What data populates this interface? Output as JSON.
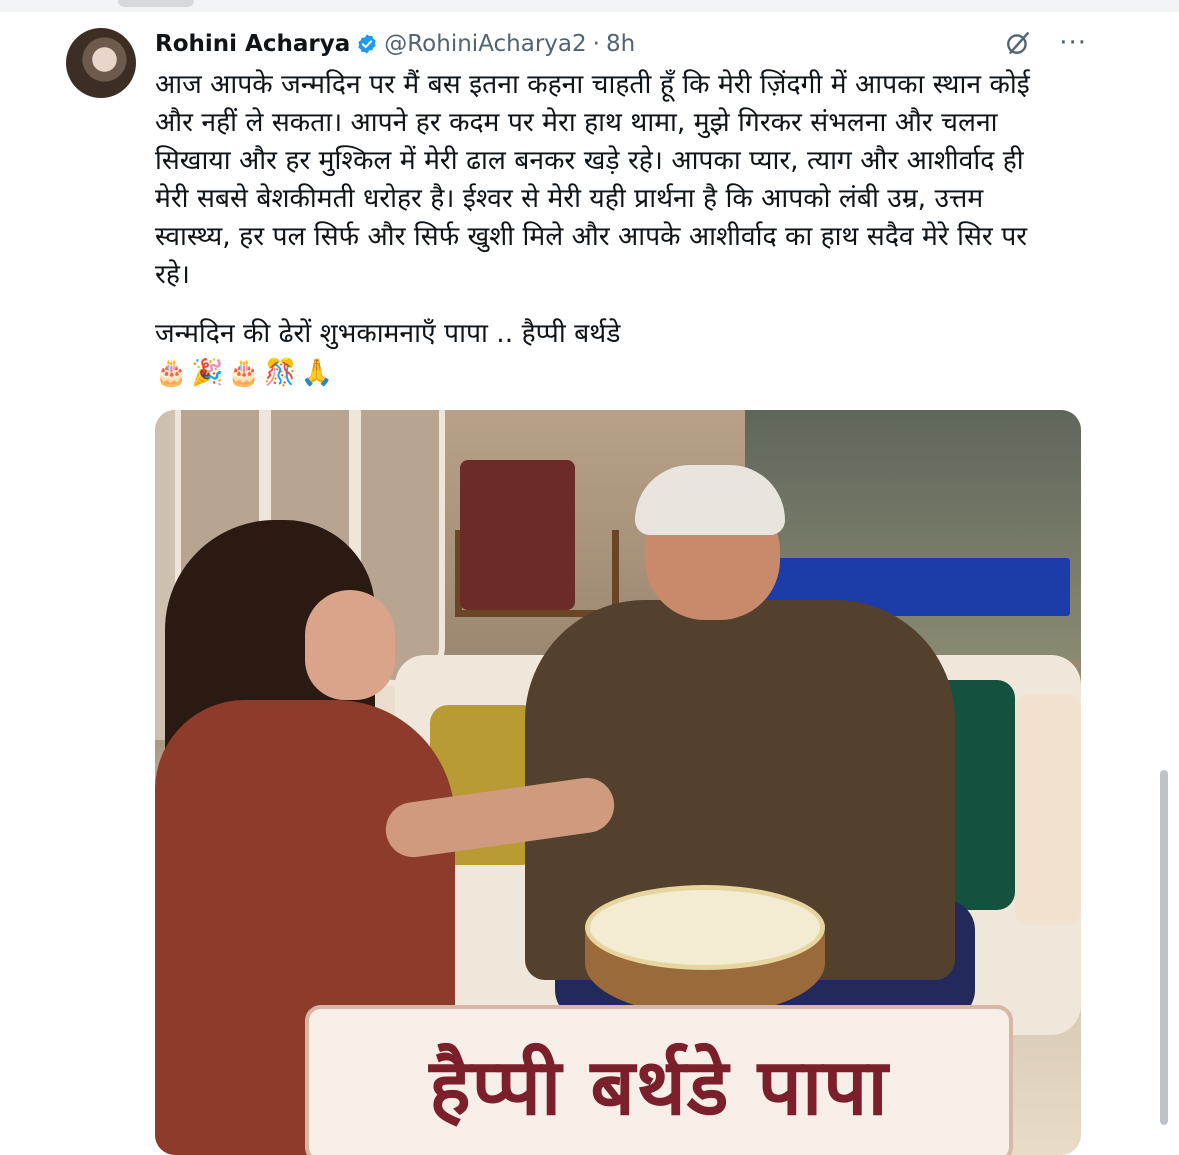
{
  "tweet": {
    "author_name": "Rohini Acharya",
    "handle": "@RohiniAcharya2",
    "separator": "·",
    "time": "8h",
    "more_label": "···",
    "text": "आज आपके जन्मदिन पर मैं बस इतना कहना चाहती हूँ कि मेरी ज़िंदगी में आपका स्थान कोई\nऔर नहीं ले सकता। आपने हर कदम पर मेरा हाथ थामा, मुझे गिरकर संभलना और चलना\nसिखाया और हर मुश्किल में मेरी ढाल बनकर खड़े रहे। आपका प्यार, त्याग और आशीर्वाद ही\nमेरी सबसे बेशकीमती धरोहर है। ईश्वर से मेरी यही प्रार्थना है कि आपको लंबी उम्र, उत्तम\nस्वास्थ्य, हर पल सिर्फ और सिर्फ खुशी मिले और आपके आशीर्वाद का हाथ सदैव मेरे सिर पर\nरहे।",
    "wish": "जन्मदिन की ढेरों शुभकामनाएँ पापा .. हैप्पी बर्थडे",
    "emojis": [
      "🎂",
      "🎉",
      "🎂",
      "🎊",
      "🙏"
    ]
  },
  "media": {
    "banner_text": "हैप्पी बर्थडे पापा"
  },
  "colors": {
    "text": "#0f1419",
    "secondary": "#536471",
    "verified": "#1d9bf0",
    "banner": "#7a1f2b"
  }
}
